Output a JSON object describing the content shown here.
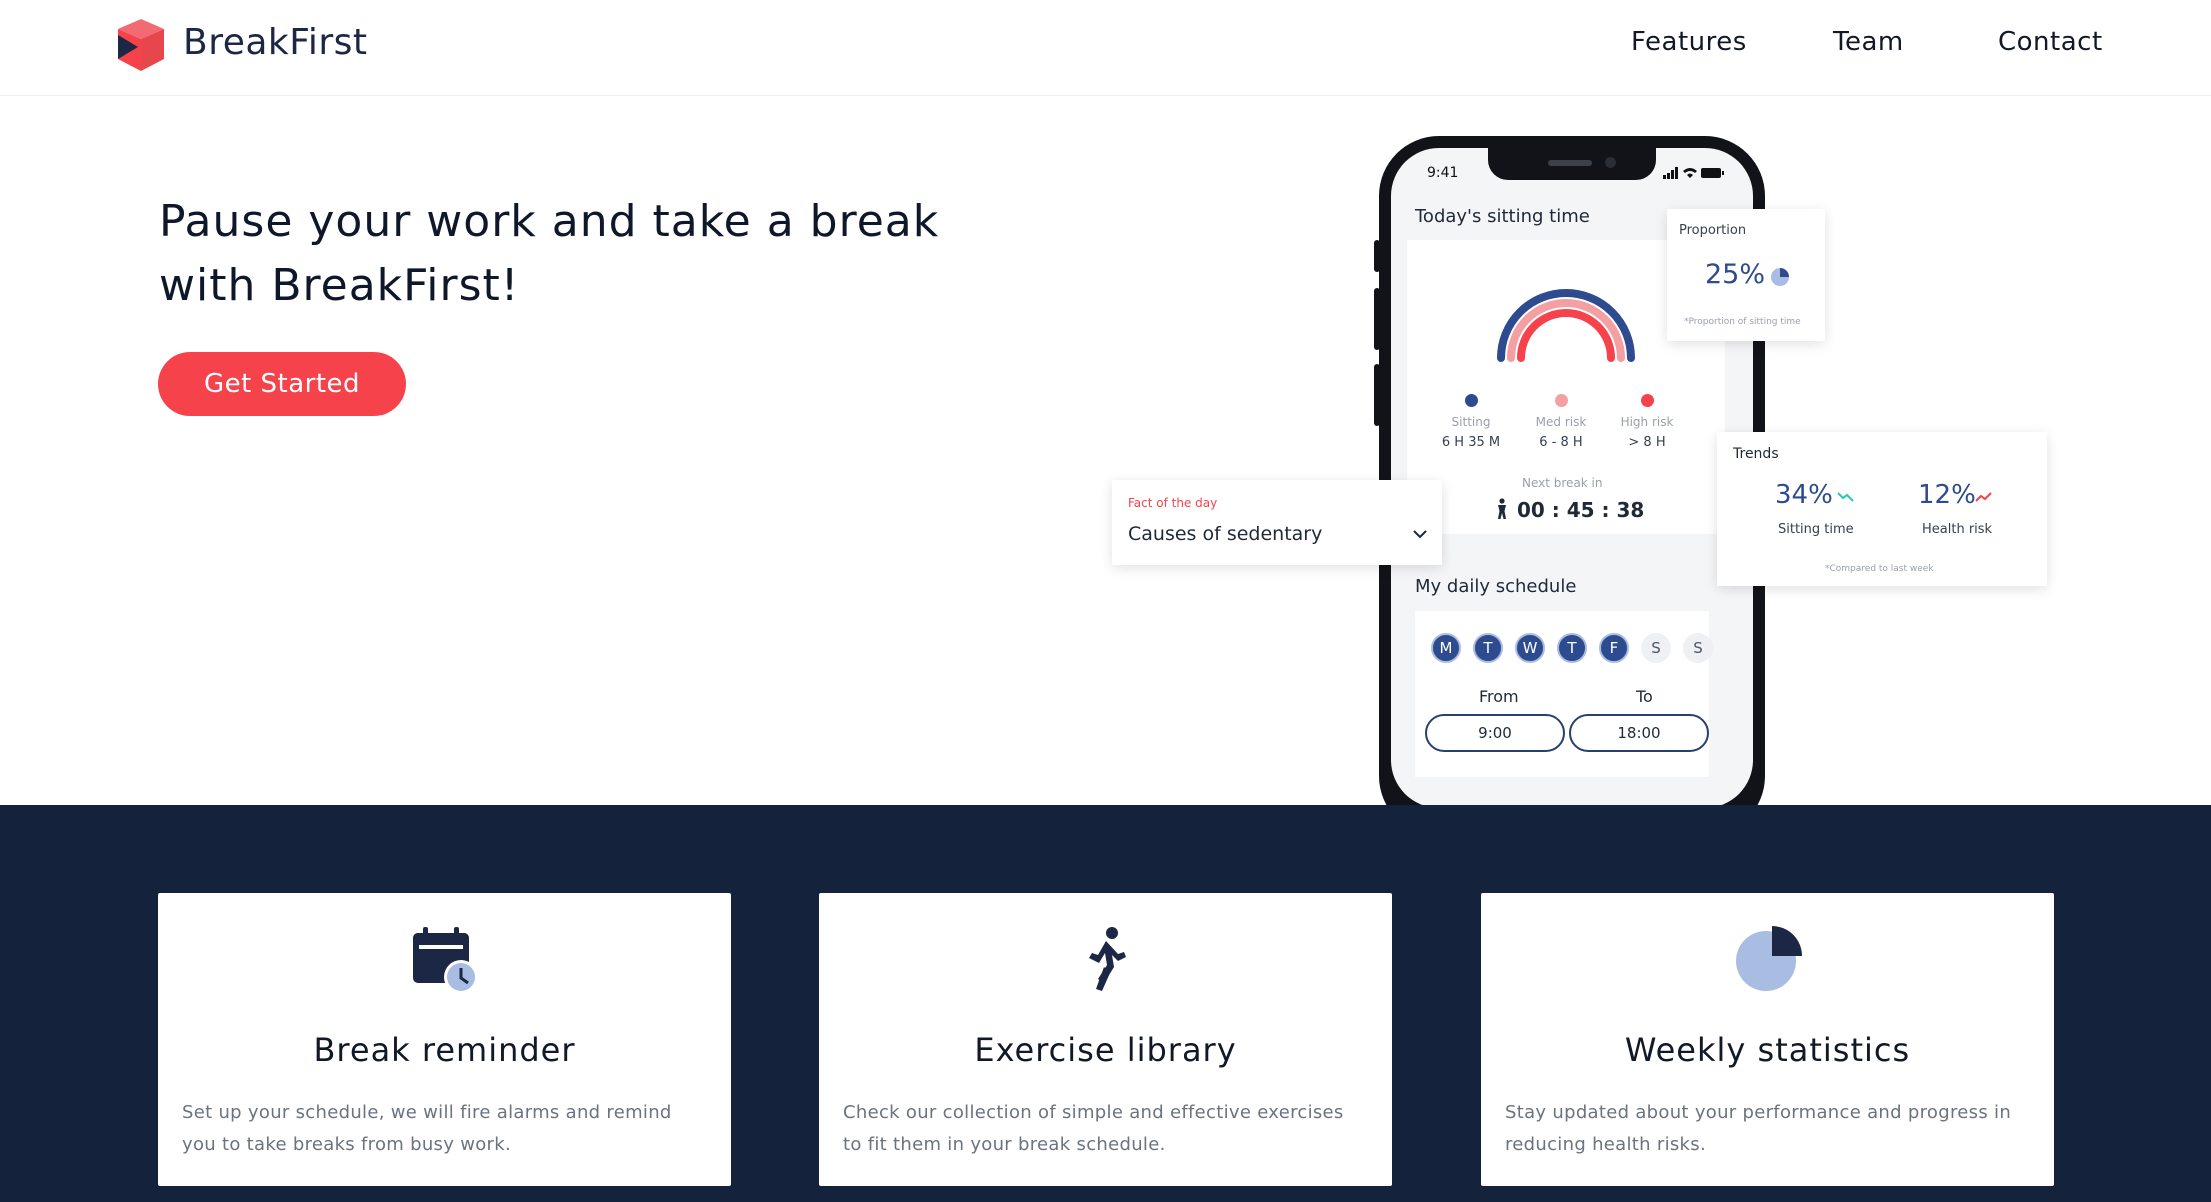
{
  "header": {
    "brand": "BreakFirst",
    "nav": [
      "Features",
      "Team",
      "Contact"
    ]
  },
  "hero": {
    "title": "Pause your work and take a break with BreakFirst!",
    "cta": "Get Started"
  },
  "phone": {
    "status_time": "9:41",
    "sitting_title": "Today's sitting time",
    "legend": [
      {
        "label": "Sitting",
        "value": "6 H 35 M",
        "color": "#2d4b8e"
      },
      {
        "label": "Med risk",
        "value": "6 - 8 H",
        "color": "#f4a0a3"
      },
      {
        "label": "High risk",
        "value": "> 8 H",
        "color": "#f6434b"
      }
    ],
    "next_break_label": "Next break in",
    "next_break_time": "00 : 45 : 38",
    "schedule_title": "My daily schedule",
    "days": [
      "M",
      "T",
      "W",
      "T",
      "F",
      "S",
      "S"
    ],
    "active_days": [
      true,
      true,
      true,
      true,
      true,
      false,
      false
    ],
    "from_label": "From",
    "to_label": "To",
    "from_value": "9:00",
    "to_value": "18:00"
  },
  "fact": {
    "label": "Fact of the day",
    "value": "Causes of sedentary"
  },
  "proportion": {
    "title": "Proportion",
    "value": "25%",
    "fraction": 0.25,
    "note": "*Proportion of sitting time"
  },
  "trends": {
    "title": "Trends",
    "items": [
      {
        "value": "34%",
        "label": "Sitting time",
        "direction": "down",
        "color": "#2ec4b6"
      },
      {
        "value": "12%",
        "label": "Health risk",
        "direction": "up",
        "color": "#f6434b"
      }
    ],
    "note": "*Compared to last week"
  },
  "features": [
    {
      "icon": "calendar-clock-icon",
      "title": "Break reminder",
      "desc": "Set up your schedule, we will fire alarms and remind you to take breaks from busy work."
    },
    {
      "icon": "running-person-icon",
      "title": "Exercise library",
      "desc": "Check our collection of simple and effective exercises to fit them in your break schedule."
    },
    {
      "icon": "pie-chart-icon",
      "title": "Weekly statistics",
      "desc": "Stay updated about your performance and progress in reducing health risks."
    }
  ],
  "colors": {
    "accent": "#f6434b",
    "navy": "#15223c",
    "brand_blue": "#2d4b8e"
  }
}
